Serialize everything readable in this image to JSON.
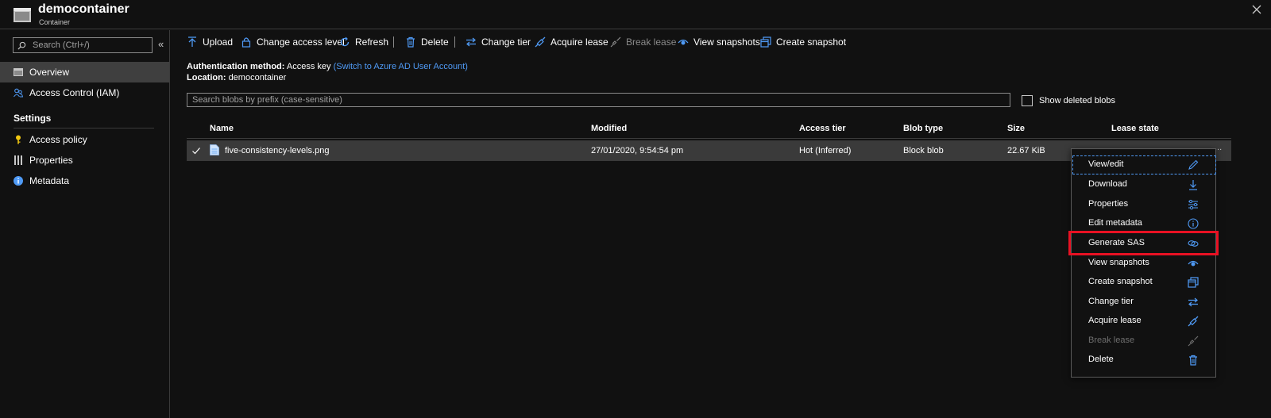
{
  "header": {
    "title": "democontainer",
    "subtitle": "Container"
  },
  "sidebar": {
    "search_placeholder": "Search (Ctrl+/)",
    "collapse": "«",
    "items": [
      {
        "label": "Overview",
        "icon": "container-icon"
      },
      {
        "label": "Access Control (IAM)",
        "icon": "people-icon"
      }
    ],
    "settings_heading": "Settings",
    "settings_items": [
      {
        "label": "Access policy",
        "icon": "key-icon"
      },
      {
        "label": "Properties",
        "icon": "properties-icon"
      },
      {
        "label": "Metadata",
        "icon": "info-icon"
      }
    ]
  },
  "toolbar": {
    "upload": "Upload",
    "change_access": "Change access level",
    "refresh": "Refresh",
    "delete": "Delete",
    "change_tier": "Change tier",
    "acquire_lease": "Acquire lease",
    "break_lease": "Break lease",
    "view_snapshots": "View snapshots",
    "create_snapshot": "Create snapshot"
  },
  "info": {
    "auth_label": "Authentication method:",
    "auth_value": "Access key",
    "auth_link": "(Switch to Azure AD User Account)",
    "location_label": "Location:",
    "location_value": "democontainer"
  },
  "blob_search_placeholder": "Search blobs by prefix (case-sensitive)",
  "show_deleted": "Show deleted blobs",
  "table": {
    "columns": [
      "Name",
      "Modified",
      "Access tier",
      "Blob type",
      "Size",
      "Lease state"
    ],
    "rows": [
      {
        "name": "five-consistency-levels.png",
        "modified": "27/01/2020, 9:54:54 pm",
        "tier": "Hot (Inferred)",
        "type": "Block blob",
        "size": "22.67 KiB",
        "more": "..."
      }
    ]
  },
  "menu": {
    "items": [
      {
        "label": "View/edit",
        "icon": "pencil-icon"
      },
      {
        "label": "Download",
        "icon": "download-icon"
      },
      {
        "label": "Properties",
        "icon": "sliders-icon"
      },
      {
        "label": "Edit metadata",
        "icon": "info-circle-icon"
      },
      {
        "label": "Generate SAS",
        "icon": "link-icon"
      },
      {
        "label": "View snapshots",
        "icon": "eye-icon"
      },
      {
        "label": "Create snapshot",
        "icon": "snapshot-icon"
      },
      {
        "label": "Change tier",
        "icon": "swap-icon"
      },
      {
        "label": "Acquire lease",
        "icon": "lease-icon"
      },
      {
        "label": "Break lease",
        "icon": "break-lease-icon"
      },
      {
        "label": "Delete",
        "icon": "trash-icon"
      }
    ]
  },
  "colors": {
    "accent": "#4f9af5",
    "highlight": "#e81123",
    "background": "#111111",
    "row_selected": "#3a3a3a"
  }
}
